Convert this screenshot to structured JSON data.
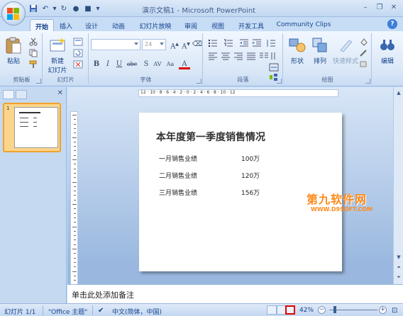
{
  "window": {
    "title": "演示文稿1 - Microsoft PowerPoint"
  },
  "tabs": [
    {
      "label": "开始",
      "active": true
    },
    {
      "label": "插入"
    },
    {
      "label": "设计"
    },
    {
      "label": "动画"
    },
    {
      "label": "幻灯片放映"
    },
    {
      "label": "审阅"
    },
    {
      "label": "视图"
    },
    {
      "label": "开发工具"
    },
    {
      "label": "Community Clips"
    }
  ],
  "ribbon": {
    "clipboard": {
      "paste": "粘贴",
      "label": "剪贴板"
    },
    "slides": {
      "new_slide_line1": "新建",
      "new_slide_line2": "幻灯片",
      "label": "幻灯片"
    },
    "font": {
      "font_name": "",
      "font_size": "24",
      "label": "字体"
    },
    "paragraph": {
      "label": "段落"
    },
    "drawing": {
      "shapes": "形状",
      "arrange": "排列",
      "quick_styles": "快速样式",
      "label": "绘图"
    },
    "editing": {
      "label": "编辑"
    }
  },
  "ruler": {
    "horizontal": "12 · 10 · 8 · 6 · 4 · 2 · 0 · 2 · 4 · 6 · 8 · 10 · 12"
  },
  "thumbnails": [
    {
      "number": "1"
    }
  ],
  "slide": {
    "title": "本年度第一季度销售情况",
    "rows": [
      {
        "label": "一月销售业绩",
        "value": "100万"
      },
      {
        "label": "二月销售业绩",
        "value": "120万"
      },
      {
        "label": "三月销售业绩",
        "value": "156万"
      }
    ]
  },
  "watermark": {
    "main": "第九软件网",
    "sub": "WWW.D9SOFT.COM"
  },
  "notes": {
    "placeholder": "单击此处添加备注"
  },
  "status": {
    "slide_info": "幻灯片 1/1",
    "theme": "\"Office 主题\"",
    "language": "中文(简体，中国)",
    "zoom": "42%"
  },
  "colors": {
    "accent": "#15428b",
    "highlight_box": "#e00000",
    "watermark": "#ff8a1a"
  }
}
